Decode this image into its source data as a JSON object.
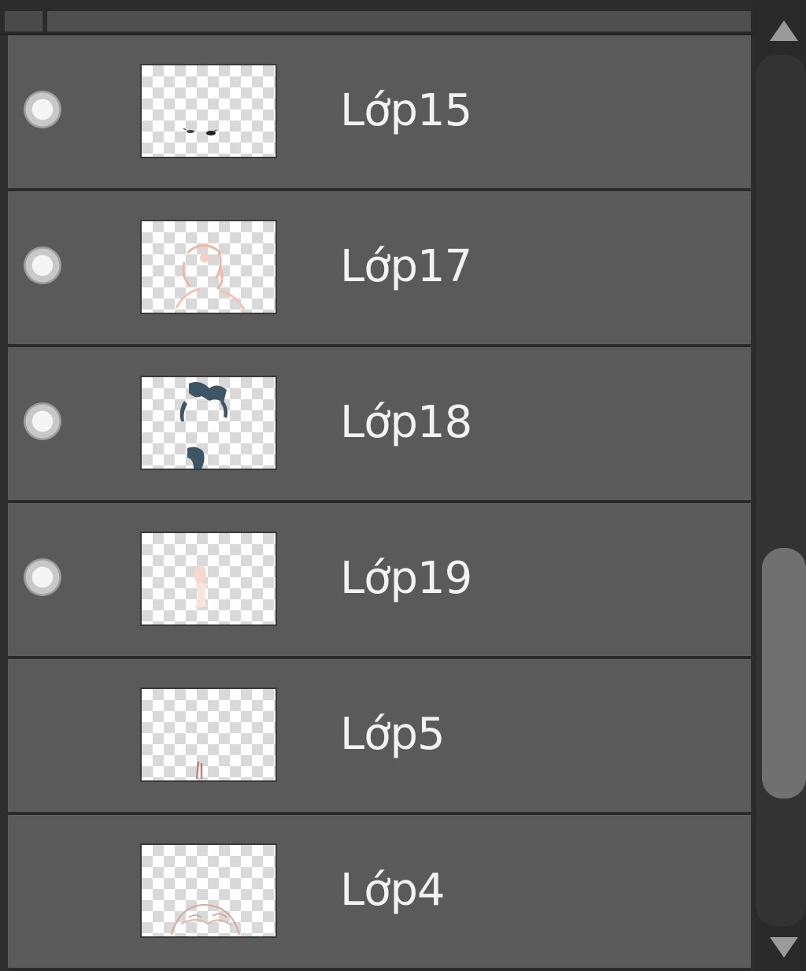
{
  "layers": [
    {
      "name": "Lớp15",
      "visible": true,
      "thumbnail": "eyes-sketch"
    },
    {
      "name": "Lớp17",
      "visible": true,
      "thumbnail": "skin-sketch"
    },
    {
      "name": "Lớp18",
      "visible": true,
      "thumbnail": "dark-hair-sketch"
    },
    {
      "name": "Lớp19",
      "visible": true,
      "thumbnail": "hand-sketch"
    },
    {
      "name": "Lớp5",
      "visible": false,
      "thumbnail": "small-mark-sketch"
    },
    {
      "name": "Lớp4",
      "visible": false,
      "thumbnail": "bottom-sketch"
    }
  ],
  "colors": {
    "row_bg": "#5a5a5a",
    "row_divider": "#2a2a2a",
    "text": "#f2f2f2",
    "dark_blue": "#3e5566",
    "skin_pink": "#f0b8a8"
  },
  "scrollbar": {
    "icons": [
      "scroll-up-arrow-icon",
      "scroll-down-arrow-icon"
    ]
  }
}
